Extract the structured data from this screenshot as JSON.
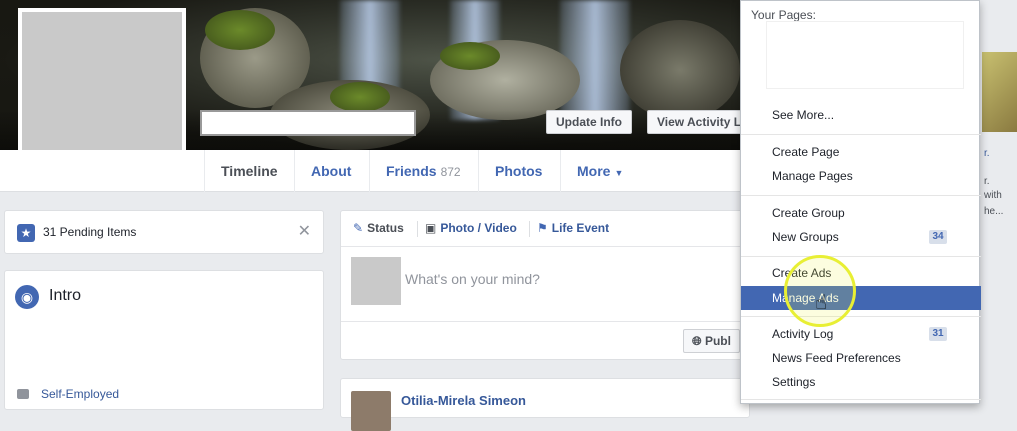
{
  "cover": {
    "update_info_label": "Update Info",
    "view_activity_label": "View Activity L"
  },
  "tabs": [
    {
      "label": "Timeline"
    },
    {
      "label": "About"
    },
    {
      "label": "Friends",
      "count": "872"
    },
    {
      "label": "Photos"
    },
    {
      "label": "More"
    }
  ],
  "left": {
    "pending_text": "31 Pending Items",
    "intro_title": "Intro",
    "work_text": "Self-Employed"
  },
  "composer": {
    "status_label": "Status",
    "photo_video_label": "Photo / Video",
    "life_event_label": "Life Event",
    "placeholder": "What's on your mind?",
    "public_label": "Publ"
  },
  "post": {
    "author": "Otilia-Mirela Simeon"
  },
  "dropdown": {
    "heading": "Your Pages:",
    "items": [
      {
        "label": "See More..."
      },
      {
        "label": "Create Page"
      },
      {
        "label": "Manage Pages"
      },
      {
        "label": "Create Group"
      },
      {
        "label": "New Groups",
        "badge": "34"
      },
      {
        "label": "Create Ads"
      },
      {
        "label": "Manage Ads"
      },
      {
        "label": "Activity Log",
        "badge": "31"
      },
      {
        "label": "News Feed Preferences"
      },
      {
        "label": "Settings"
      }
    ]
  },
  "right_strip": {
    "lines": [
      "r.",
      "r.",
      "with",
      "he..."
    ]
  },
  "colors": {
    "brand": "#4267b2",
    "link": "#365899",
    "highlight_ring": "#e8ef34"
  }
}
